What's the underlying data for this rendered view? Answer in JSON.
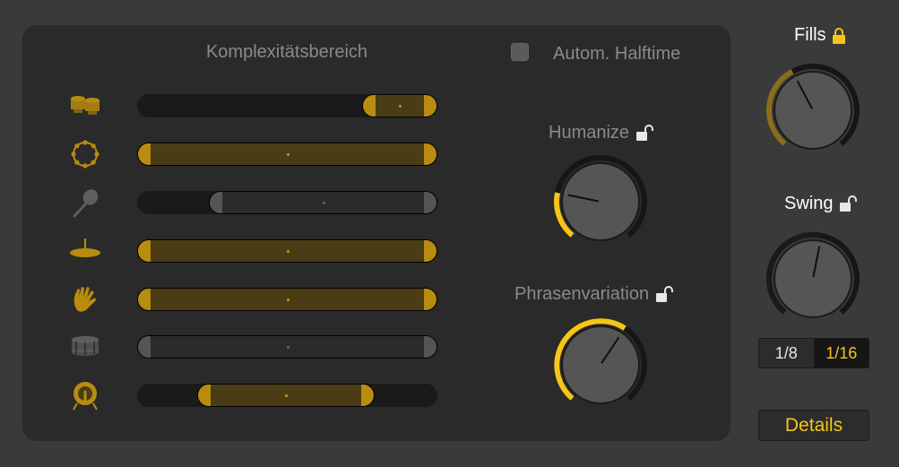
{
  "complexity": {
    "title": "Komplexitätsbereich",
    "rows": [
      {
        "icon": "bongos-icon",
        "active": true,
        "range_start": 0.75,
        "range_end": 1.0
      },
      {
        "icon": "tambourine-icon",
        "active": true,
        "range_start": 0.0,
        "range_end": 1.0
      },
      {
        "icon": "maraca-icon",
        "active": false,
        "range_start": 0.24,
        "range_end": 1.0
      },
      {
        "icon": "cymbal-icon",
        "active": true,
        "range_start": 0.0,
        "range_end": 1.0
      },
      {
        "icon": "hand-clap-icon",
        "active": true,
        "range_start": 0.0,
        "range_end": 1.0
      },
      {
        "icon": "snare-drum-icon",
        "active": false,
        "range_start": 0.0,
        "range_end": 1.0
      },
      {
        "icon": "bass-drum-icon",
        "active": true,
        "range_start": 0.2,
        "range_end": 0.79
      }
    ]
  },
  "halftime": {
    "label": "Autom. Halftime",
    "checked": false
  },
  "humanize": {
    "label": "Humanize",
    "locked": false,
    "value": 0.22
  },
  "phrase": {
    "label": "Phrasenvariation",
    "locked": false,
    "value": 0.62
  },
  "fills": {
    "label": "Fills",
    "locked": true,
    "value": 0.4
  },
  "swing": {
    "label": "Swing",
    "locked": false,
    "value": 0.54
  },
  "resolution": {
    "options": [
      "1/8",
      "1/16"
    ],
    "selected": "1/16"
  },
  "details_label": "Details",
  "colors": {
    "accent": "#f5c518",
    "dim_accent": "#8a6e1c",
    "panel": "#2a2a2a",
    "background": "#3a3a3a"
  }
}
